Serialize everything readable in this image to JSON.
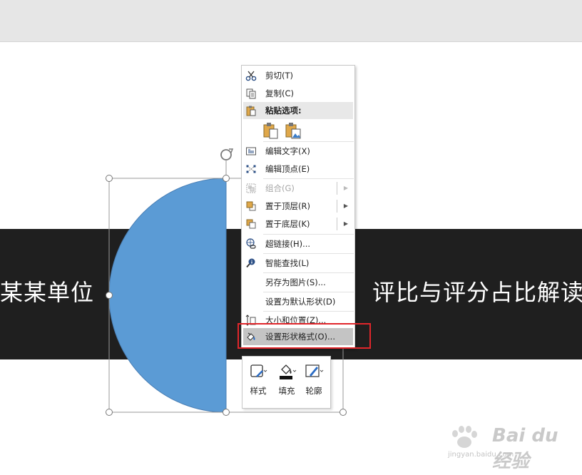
{
  "slide": {
    "left_text": "某某单位",
    "right_text": "评比与评分占比解读"
  },
  "colors": {
    "band": "#1f1f1f",
    "shape_fill": "#5b9bd5",
    "highlight": "#c4c4c4",
    "annotation": "#e0262b"
  },
  "context_menu": {
    "cut": "剪切(T)",
    "copy": "复制(C)",
    "paste_options": "粘贴选项:",
    "edit_text": "编辑文字(X)",
    "edit_points": "编辑顶点(E)",
    "group": "组合(G)",
    "bring_to_front": "置于顶层(R)",
    "send_to_back": "置于底层(K)",
    "hyperlink": "超链接(H)...",
    "smart_lookup": "智能查找(L)",
    "save_as_picture": "另存为图片(S)...",
    "set_default_shape": "设置为默认形状(D)",
    "size_position": "大小和位置(Z)...",
    "format_shape": "设置形状格式(O)..."
  },
  "mini_toolbar": {
    "style": "样式",
    "fill": "填充",
    "outline": "轮廓"
  },
  "watermark": {
    "brand": "Bai du 经验",
    "url": "jingyan.baidu.com"
  }
}
